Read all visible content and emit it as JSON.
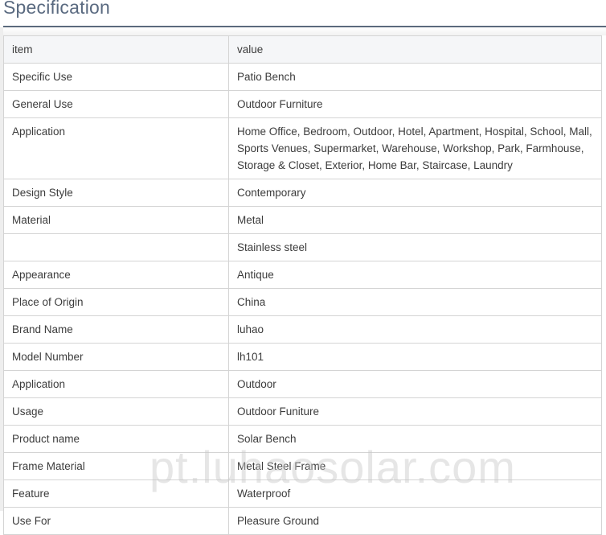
{
  "title": "Specification",
  "table": {
    "header": {
      "item": "item",
      "value": "value"
    },
    "rows": [
      {
        "item": "Specific Use",
        "value": "Patio Bench"
      },
      {
        "item": "General Use",
        "value": "Outdoor Furniture"
      },
      {
        "item": "Application",
        "value": "Home Office, Bedroom, Outdoor, Hotel, Apartment, Hospital, School, Mall, Sports Venues, Supermarket, Warehouse, Workshop, Park, Farmhouse, Storage & Closet, Exterior, Home Bar, Staircase, Laundry"
      },
      {
        "item": "Design Style",
        "value": "Contemporary"
      },
      {
        "item": "Material",
        "value": "Metal"
      },
      {
        "item": "",
        "value": "Stainless steel"
      },
      {
        "item": "Appearance",
        "value": "Antique"
      },
      {
        "item": "Place of Origin",
        "value": "China"
      },
      {
        "item": "Brand Name",
        "value": "luhao"
      },
      {
        "item": "Model Number",
        "value": "lh101"
      },
      {
        "item": "Application",
        "value": "Outdoor"
      },
      {
        "item": "Usage",
        "value": "Outdoor Funiture"
      },
      {
        "item": "Product name",
        "value": "Solar Bench"
      },
      {
        "item": "Frame Material",
        "value": "Metal Steel Frame"
      },
      {
        "item": "Feature",
        "value": "Waterproof"
      },
      {
        "item": "Use For",
        "value": "Pleasure Ground"
      }
    ]
  },
  "watermark": "pt.luhaosolar.com"
}
